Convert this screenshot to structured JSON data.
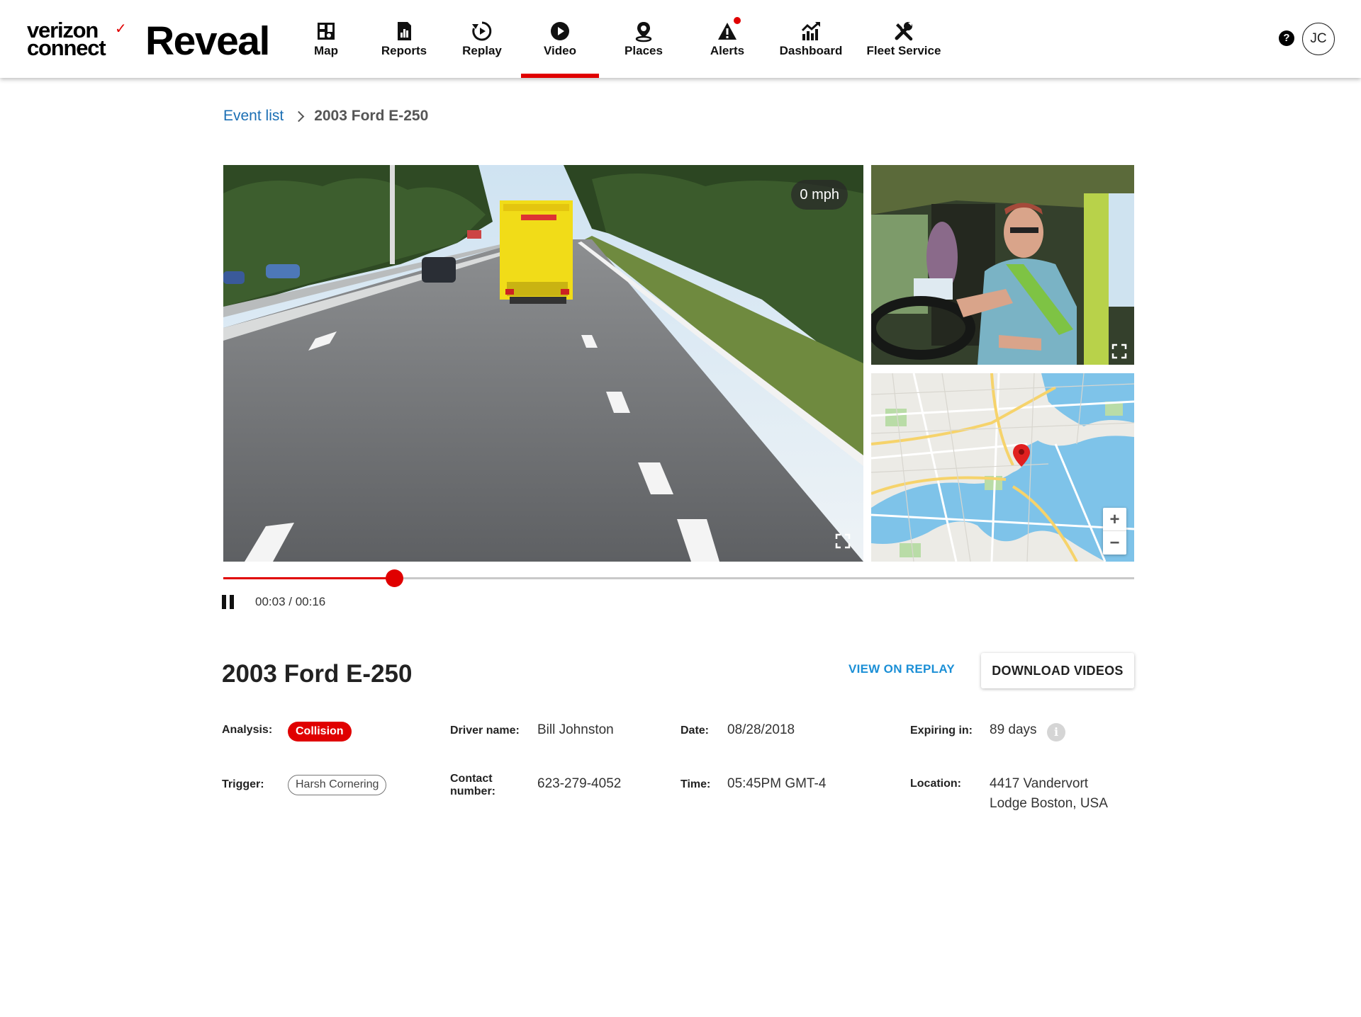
{
  "brand": {
    "line1": "verizon",
    "line2": "connect",
    "product": "Reveal",
    "accent": "#e00000"
  },
  "nav": {
    "items": [
      {
        "label": "Map",
        "icon": "map-icon"
      },
      {
        "label": "Reports",
        "icon": "reports-icon"
      },
      {
        "label": "Replay",
        "icon": "replay-icon"
      },
      {
        "label": "Video",
        "icon": "video-play-icon",
        "active": true
      },
      {
        "label": "Places",
        "icon": "places-pin-icon"
      },
      {
        "label": "Alerts",
        "icon": "alert-warning-icon"
      },
      {
        "label": "Dashboard",
        "icon": "dashboard-chart-icon"
      },
      {
        "label": "Fleet Service",
        "icon": "fleet-service-tools-icon"
      }
    ]
  },
  "header": {
    "help": "?",
    "avatar_initials": "JC"
  },
  "breadcrumb": {
    "parent": "Event list",
    "current": "2003 Ford E-250"
  },
  "video": {
    "speed": "0 mph"
  },
  "playback": {
    "current": "00:03",
    "separator": " / ",
    "total": "00:16",
    "progress_fraction": 0.1875
  },
  "details": {
    "title": "2003 Ford E-250",
    "view_on_replay": "VIEW ON REPLAY",
    "download": "DOWNLOAD VIDEOS",
    "analysis_label": "Analysis:",
    "analysis_value": "Collision",
    "trigger_label": "Trigger:",
    "trigger_value": "Harsh Cornering",
    "driver_label": "Driver name:",
    "driver_value": "Bill Johnston",
    "contact_label_1": "Contact",
    "contact_label_2": "number:",
    "contact_value": "623-279-4052",
    "date_label": "Date:",
    "date_value": "08/28/2018",
    "time_label": "Time:",
    "time_value": "05:45PM GMT-4",
    "expiring_label": "Expiring in:",
    "expiring_value": "89 days",
    "info": "i",
    "location_label": "Location:",
    "location_line1": "4417 Vandervort",
    "location_line2": "Lodge Boston, USA"
  },
  "map": {
    "zoom_in": "+",
    "zoom_out": "−"
  }
}
